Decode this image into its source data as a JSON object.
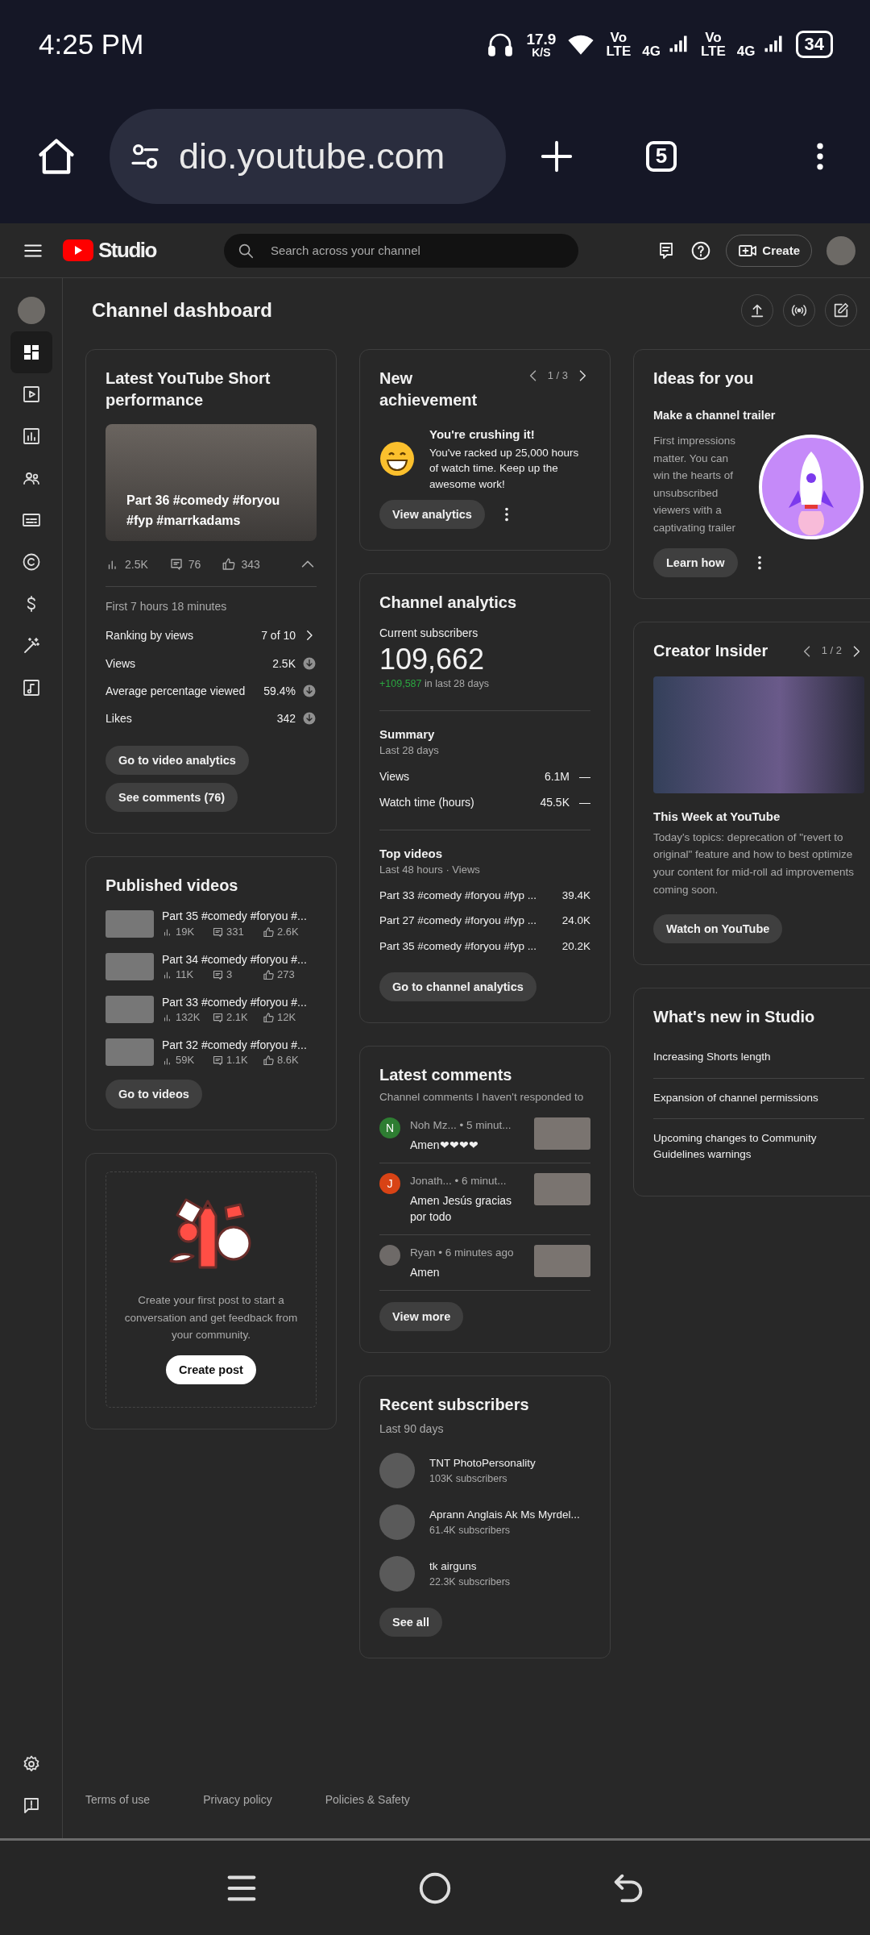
{
  "status_bar": {
    "time": "4:25 PM",
    "speed": "17.9",
    "speed_unit": "K/S",
    "sims": [
      {
        "vo": "Vo",
        "lte": "LTE",
        "network": "4G"
      },
      {
        "vo": "Vo",
        "lte": "LTE",
        "network": "4G"
      }
    ],
    "battery": "34"
  },
  "browser": {
    "url": "dio.youtube.com",
    "tab_count": "5"
  },
  "header": {
    "logo": "Studio",
    "search": {
      "placeholder": "Search across your channel"
    },
    "create_button": "Create"
  },
  "sidebar": {
    "items": [
      {
        "kind": "channel",
        "selected": false
      },
      {
        "kind": "dashboard",
        "selected": true
      },
      {
        "kind": "content",
        "selected": false
      },
      {
        "kind": "analytics",
        "selected": false
      },
      {
        "kind": "community",
        "selected": false
      },
      {
        "kind": "subtitles",
        "selected": false
      },
      {
        "kind": "copyright",
        "selected": false
      },
      {
        "kind": "earn",
        "selected": false
      },
      {
        "kind": "customization",
        "selected": false
      },
      {
        "kind": "audio",
        "selected": false
      }
    ],
    "bottom_items": [
      {
        "kind": "settings",
        "selected": false
      },
      {
        "kind": "feedback",
        "selected": false
      }
    ]
  },
  "page_title": "Channel dashboard",
  "latest_short": {
    "title": "Latest YouTube Short performance",
    "video_title": "Part 36 #comedy #foryou #fyp #marrkadams",
    "views": "2.5K",
    "comments": "76",
    "likes": "343",
    "expanded": true,
    "period": "First 7 hours 18 minutes",
    "ranking": {
      "label": "Ranking by views",
      "value": "7 of 10"
    },
    "metrics": [
      {
        "label": "Views",
        "value": "2.5K"
      },
      {
        "label": "Average percentage viewed",
        "value": "59.4%"
      },
      {
        "label": "Likes",
        "value": "342"
      }
    ],
    "buttons": [
      "Go to video analytics",
      "See comments (76)"
    ]
  },
  "published_videos": {
    "title": "Published videos",
    "videos": [
      {
        "title": "Part 35 #comedy #foryou #...",
        "views": "19K",
        "comments": "331",
        "likes": "2.6K"
      },
      {
        "title": "Part 34 #comedy #foryou #...",
        "views": "11K",
        "comments": "3",
        "likes": "273"
      },
      {
        "title": "Part 33 #comedy #foryou #...",
        "views": "132K",
        "comments": "2.1K",
        "likes": "12K"
      },
      {
        "title": "Part 32 #comedy #foryou #...",
        "views": "59K",
        "comments": "1.1K",
        "likes": "8.6K"
      }
    ],
    "button": "Go to videos"
  },
  "community_post": {
    "text": "Create your first post to start a conversation and get feedback from your community.",
    "button": "Create post"
  },
  "achievement": {
    "title": "New achievement",
    "pager": "1 / 3",
    "heading": "You're crushing it!",
    "text": "You've racked up 25,000 hours of watch time. Keep up the awesome work!",
    "button": "View analytics"
  },
  "channel_analytics": {
    "title": "Channel analytics",
    "subscribers_label": "Current subscribers",
    "subscribers": "109,662",
    "change": "+109,587",
    "change_suffix": "in last 28 days",
    "summary_title": "Summary",
    "summary_period": "Last 28 days",
    "summary": [
      {
        "label": "Views",
        "value": "6.1M",
        "trend": "—"
      },
      {
        "label": "Watch time (hours)",
        "value": "45.5K",
        "trend": "—"
      }
    ],
    "top_title": "Top videos",
    "top_period": "Last 48 hours · Views",
    "top_videos": [
      {
        "title": "Part 33 #comedy #foryou #fyp ...",
        "views": "39.4K"
      },
      {
        "title": "Part 27 #comedy #foryou #fyp ...",
        "views": "24.0K"
      },
      {
        "title": "Part 35 #comedy #foryou #fyp ...",
        "views": "20.2K"
      }
    ],
    "button": "Go to channel analytics"
  },
  "latest_comments": {
    "title": "Latest comments",
    "subtitle": "Channel comments I haven't responded to",
    "comments": [
      {
        "kind": "letter",
        "letter": "N",
        "color": "#2e7d32",
        "author": "Noh Mz...",
        "time": "• 5 minut...",
        "text": "Amen❤❤❤❤"
      },
      {
        "kind": "letter",
        "letter": "J",
        "color": "#d84315",
        "author": "Jonath...",
        "time": "• 6 minut...",
        "text": "Amen Jesús gracias por todo"
      },
      {
        "kind": "photo",
        "author": "Ryan",
        "time": "• 6 minutes ago",
        "text": "Amen"
      }
    ],
    "button": "View more"
  },
  "recent_subscribers": {
    "title": "Recent subscribers",
    "period": "Last 90 days",
    "subscribers": [
      {
        "name": "TNT PhotoPersonality",
        "count": "103K subscribers"
      },
      {
        "name": "Aprann Anglais Ak Ms Myrdel...",
        "count": "61.4K subscribers"
      },
      {
        "name": "tk airguns",
        "count": "22.3K subscribers"
      }
    ],
    "button": "See all"
  },
  "ideas": {
    "title": "Ideas for you",
    "heading": "Make a channel trailer",
    "text": "First impressions matter. You can win the hearts of unsubscribed viewers with a captivating trailer",
    "button": "Learn how"
  },
  "creator_insider": {
    "title": "Creator Insider",
    "pager": "1 / 2",
    "video_title": "This Week at YouTube",
    "text": "Today's topics: deprecation of \"revert to original\" feature and how to best optimize your content for mid-roll ad improvements coming soon.",
    "button": "Watch on YouTube"
  },
  "whats_new": {
    "title": "What's new in Studio",
    "items": [
      "Increasing Shorts length",
      "Expansion of channel permissions",
      "Upcoming changes to Community Guidelines warnings"
    ]
  },
  "footer": {
    "links": [
      "Terms of use",
      "Privacy policy",
      "Policies & Safety"
    ]
  }
}
